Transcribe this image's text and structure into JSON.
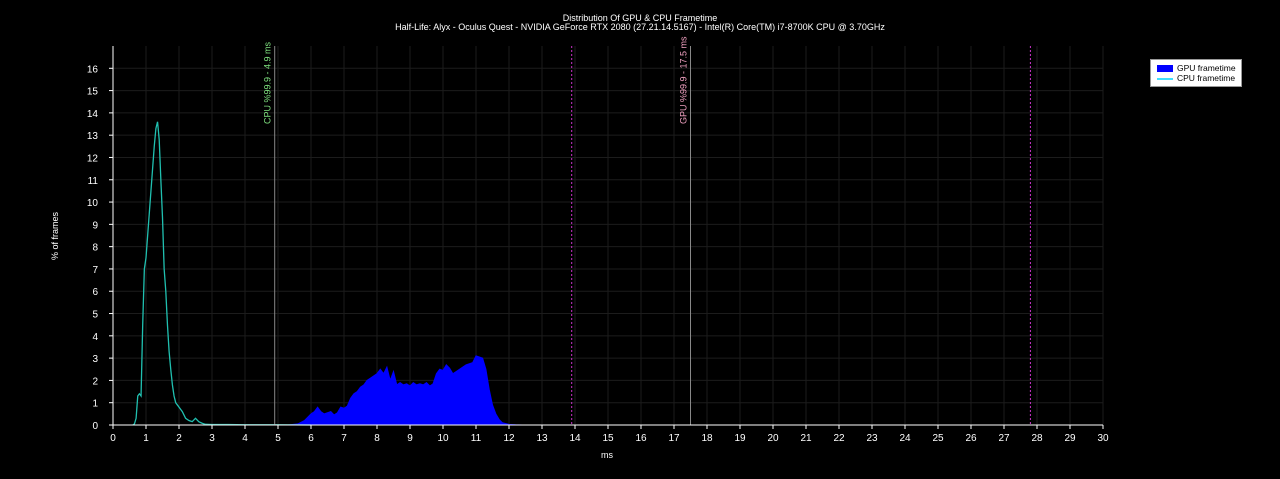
{
  "chart_data": {
    "type": "area",
    "title": "Distribution Of GPU & CPU Frametime",
    "subtitle": "Half-Life: Alyx - Oculus Quest - NVIDIA GeForce RTX 2080 (27.21.14.5167) - Intel(R) Core(TM) i7-8700K CPU @ 3.70GHz",
    "xlabel": "ms",
    "ylabel": "% of frames",
    "xlim": [
      0,
      30
    ],
    "ylim": [
      0,
      17
    ],
    "xticks": [
      0,
      1,
      2,
      3,
      4,
      5,
      6,
      7,
      8,
      9,
      10,
      11,
      12,
      13,
      14,
      15,
      16,
      17,
      18,
      19,
      20,
      21,
      22,
      23,
      24,
      25,
      26,
      27,
      28,
      29,
      30
    ],
    "yticks": [
      0,
      1,
      2,
      3,
      4,
      5,
      6,
      7,
      8,
      9,
      10,
      11,
      12,
      13,
      14,
      15,
      16
    ],
    "grid": true,
    "legend_position": "top-right",
    "colors": {
      "background": "#000000",
      "gpu": "#0000ff",
      "cpu": "#20c0b0",
      "grid": "#1c1c1c",
      "axis": "#ffffff",
      "cpu_marker_text": "#7ee07e",
      "gpu_marker_text": "#f0a0c0",
      "marker_line": "#888888",
      "refresh_line": "#cc33cc"
    },
    "series": [
      {
        "name": "GPU frametime",
        "style": "filled-area",
        "x": [
          5.3,
          5.6,
          5.8,
          6.0,
          6.1,
          6.2,
          6.3,
          6.4,
          6.5,
          6.6,
          6.7,
          6.8,
          6.9,
          7.0,
          7.1,
          7.2,
          7.3,
          7.4,
          7.5,
          7.6,
          7.7,
          7.8,
          7.9,
          8.0,
          8.1,
          8.2,
          8.3,
          8.4,
          8.5,
          8.6,
          8.7,
          8.8,
          8.9,
          9.0,
          9.1,
          9.2,
          9.3,
          9.4,
          9.5,
          9.6,
          9.7,
          9.8,
          9.9,
          10.0,
          10.1,
          10.2,
          10.3,
          10.4,
          10.5,
          10.6,
          10.7,
          10.8,
          10.9,
          11.0,
          11.1,
          11.2,
          11.3,
          11.4,
          11.5,
          11.6,
          11.7,
          11.8,
          12.0,
          12.2,
          12.4
        ],
        "y": [
          0,
          0.05,
          0.2,
          0.5,
          0.6,
          0.8,
          0.6,
          0.5,
          0.55,
          0.6,
          0.45,
          0.55,
          0.8,
          0.75,
          0.85,
          1.2,
          1.4,
          1.5,
          1.7,
          1.8,
          2.0,
          2.1,
          2.2,
          2.3,
          2.5,
          2.3,
          2.6,
          2.0,
          2.4,
          1.8,
          1.9,
          1.8,
          1.85,
          1.75,
          1.9,
          1.8,
          1.85,
          1.8,
          1.9,
          1.75,
          1.85,
          2.3,
          2.5,
          2.45,
          2.7,
          2.55,
          2.3,
          2.4,
          2.5,
          2.6,
          2.7,
          2.75,
          2.8,
          3.1,
          3.05,
          3.0,
          2.5,
          1.6,
          0.9,
          0.5,
          0.25,
          0.1,
          0.03,
          0.01,
          0
        ]
      },
      {
        "name": "CPU frametime",
        "style": "line",
        "x": [
          0.6,
          0.65,
          0.7,
          0.75,
          0.8,
          0.85,
          0.9,
          0.95,
          1.0,
          1.05,
          1.1,
          1.15,
          1.2,
          1.25,
          1.3,
          1.35,
          1.4,
          1.45,
          1.5,
          1.55,
          1.6,
          1.65,
          1.7,
          1.75,
          1.8,
          1.85,
          1.9,
          1.95,
          2.0,
          2.05,
          2.1,
          2.15,
          2.2,
          2.3,
          2.4,
          2.5,
          2.6,
          2.7,
          2.8,
          3.0,
          3.5,
          4.0,
          5.0,
          6.0
        ],
        "y": [
          0,
          0.05,
          0.3,
          1.3,
          1.4,
          1.3,
          4.5,
          7.0,
          7.5,
          8.5,
          9.5,
          10.5,
          11.5,
          12.5,
          13.3,
          13.6,
          12.8,
          11.0,
          9.3,
          7.0,
          6.0,
          4.5,
          3.3,
          2.5,
          1.8,
          1.3,
          1.0,
          0.9,
          0.8,
          0.7,
          0.6,
          0.45,
          0.3,
          0.2,
          0.15,
          0.3,
          0.15,
          0.08,
          0.03,
          0.02,
          0.02,
          0.01,
          0.01,
          0
        ]
      }
    ],
    "markers": [
      {
        "label": "CPU %99.9 - 4.9  ms",
        "x": 4.9,
        "kind": "cpu"
      },
      {
        "label": "GPU %99.9 - 17.5  ms",
        "x": 17.5,
        "kind": "gpu"
      }
    ],
    "refresh_lines": [
      13.9,
      27.8
    ]
  },
  "legend": {
    "gpu_label": "GPU frametime",
    "cpu_label": "CPU frametime"
  }
}
